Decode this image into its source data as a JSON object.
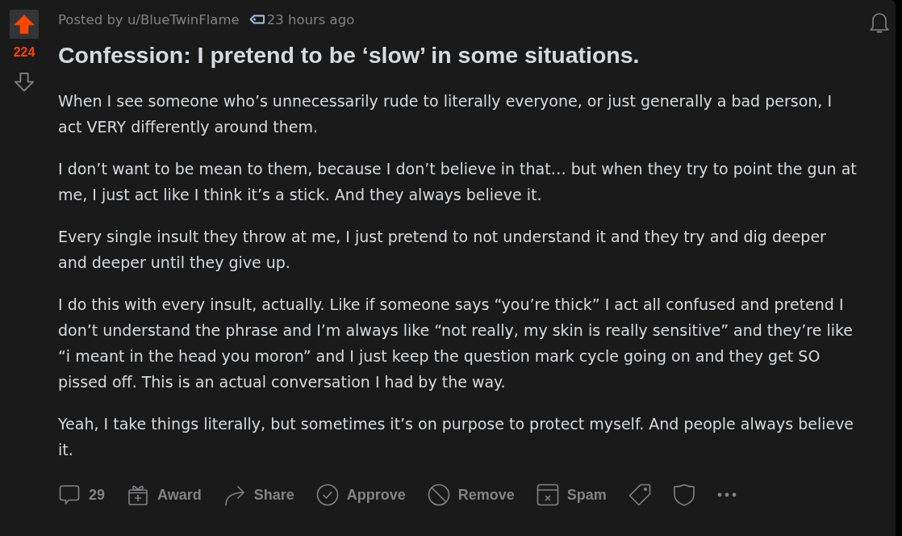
{
  "vote": {
    "upvoted": true,
    "score": "224",
    "downvoted": false
  },
  "post": {
    "author_line": "Posted by u/BlueTwinFlame",
    "time": "23 hours ago",
    "title": "Confession: I pretend to be ‘slow’ in some situations.",
    "body": [
      "When I see someone who’s unnecessarily rude to literally everyone, or just generally a bad person, I act VERY differently around them.",
      "I don’t want to be mean to them, because I don’t believe in that… but when they try to point the gun at me, I just act like I think it’s a stick. And they always believe it.",
      "Every single insult they throw at me, I just pretend to not understand it and they try and dig deeper and deeper until they give up.",
      "I do this with every insult, actually. Like if someone says “you’re thick” I act all confused and pretend I don’t understand the phrase and I’m always like “not really, my skin is really sensitive” and they’re like “i meant in the head you moron” and I just keep the question mark cycle going on and they get SO pissed off. This is an actual conversation I had by the way.",
      "Yeah, I take things literally, but sometimes it’s on purpose to protect myself. And people always believe it."
    ]
  },
  "actions": [
    {
      "kind": "comments",
      "label": "29"
    },
    {
      "kind": "award",
      "label": "Award"
    },
    {
      "kind": "share",
      "label": "Share"
    },
    {
      "kind": "approve",
      "label": "Approve"
    },
    {
      "kind": "remove",
      "label": "Remove"
    },
    {
      "kind": "spam",
      "label": "Spam"
    },
    {
      "kind": "tag"
    },
    {
      "kind": "shield"
    },
    {
      "kind": "more"
    }
  ]
}
